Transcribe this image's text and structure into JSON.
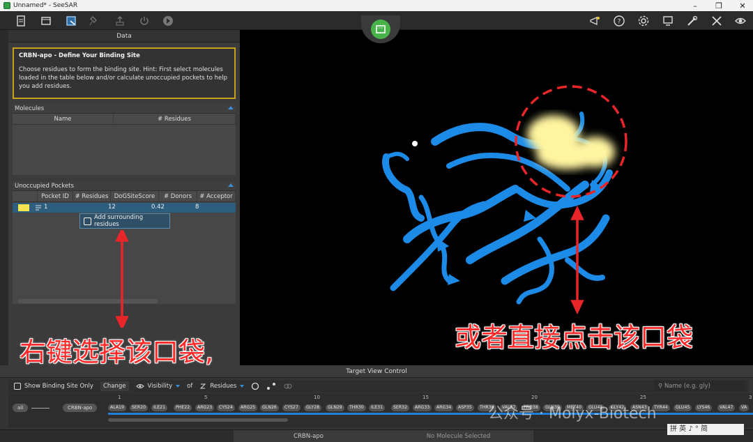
{
  "window": {
    "title": "Unnamed* - SeeSAR"
  },
  "left_panel": {
    "header": "Data",
    "info": {
      "title": "CRBN-apo - Define Your Binding Site",
      "text": "Choose residues to form the binding site. Hint: First select molecules loaded in the table below and/or calculate unoccupied pockets to help you add residues."
    },
    "molecules": {
      "title": "Molecules",
      "columns": [
        "Name",
        "# Residues"
      ]
    },
    "pockets": {
      "title": "Unoccupied Pockets",
      "columns": [
        "Pocket ID",
        "# Residues",
        "DoGSiteScore",
        "# Donors",
        "# Acceptor"
      ],
      "row": {
        "id": "1",
        "residues": "12",
        "score": "0.42",
        "donors": "8",
        "color": "#f6e34d"
      }
    },
    "context_menu": {
      "label": "Add surrounding residues"
    }
  },
  "annotations": {
    "left": "右键选择该口袋,",
    "right": "或者直接点击该口袋"
  },
  "target_view": {
    "title": "Target View Control",
    "show_binding_site": "Show Binding Site Only",
    "change": "Change",
    "visibility": "Visibility",
    "of": "of",
    "residues": "Residues",
    "search_placeholder": "Name (e.g. gly)",
    "chain_all": "all",
    "chain_name": "CRBN-apo",
    "ruler": [
      "1",
      "5",
      "10",
      "15",
      "20",
      "25",
      "3"
    ],
    "residue_list": [
      "ALA19",
      "SER20",
      "ILE21",
      "PHE22",
      "ARG23",
      "CYS24",
      "ARG25",
      "GLN26",
      "CYS27",
      "GLY28",
      "GLN29",
      "THR30",
      "ILE31",
      "SER32",
      "ARG33",
      "ARG34",
      "ASP35",
      "THR36",
      "VAL37",
      "PRO38",
      "GLN39",
      "MET40",
      "GLU41",
      "GLY42",
      "ASN43",
      "TYR44",
      "GLU45",
      "LYS46",
      "VAL47",
      "VA"
    ]
  },
  "status": {
    "left": "CRBN-apo",
    "right": "No Molecule Selected"
  },
  "watermark": "公众号 · Molyx-Biotech",
  "ime": "拼 英 ♪ ° 简"
}
